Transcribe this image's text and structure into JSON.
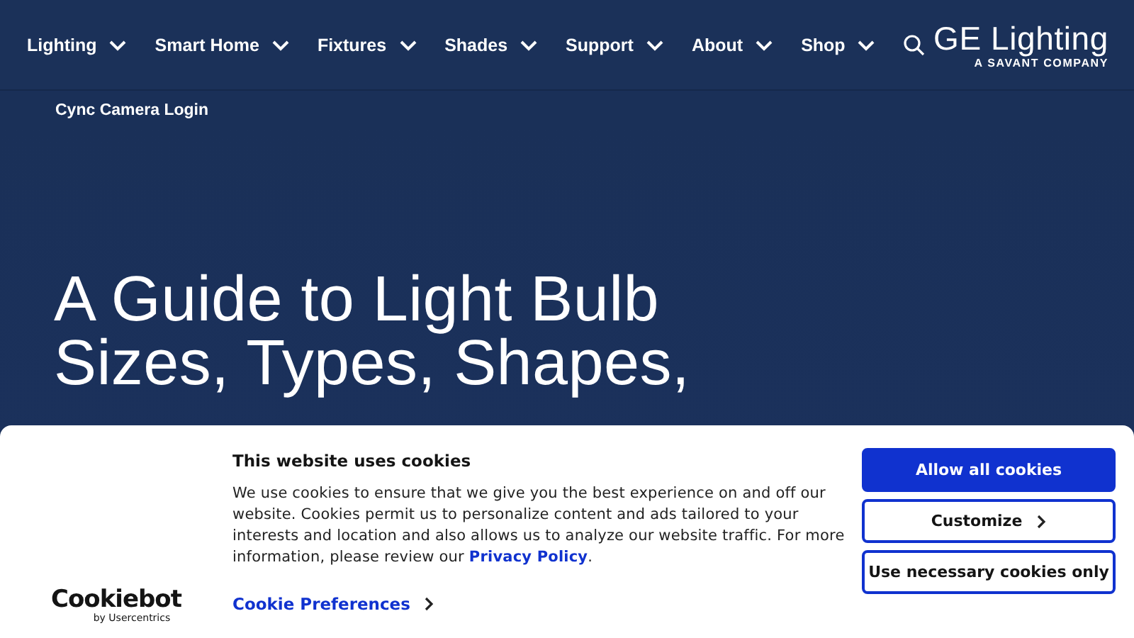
{
  "nav": {
    "items": [
      {
        "label": "Lighting"
      },
      {
        "label": "Smart Home"
      },
      {
        "label": "Fixtures"
      },
      {
        "label": "Shades"
      },
      {
        "label": "Support"
      },
      {
        "label": "About"
      },
      {
        "label": "Shop"
      }
    ],
    "logo": {
      "name": "GE Lighting",
      "tagline": "A SAVANT COMPANY"
    }
  },
  "subnav": {
    "link": "Cync Camera Login"
  },
  "hero": {
    "title_lines": [
      "A Guide to Light Bulb",
      "Sizes, Types, Shapes,"
    ]
  },
  "cookie_banner": {
    "brand": "Cookiebot",
    "brand_sub": "by Usercentrics",
    "title": "This website uses cookies",
    "body": "We use cookies to ensure that we give you the best experience on and off our website. Cookies permit us to personalize content and ads tailored to your interests and location and also allows us to analyze our website traffic.  For more information, please review our ",
    "link": "Privacy Policy",
    "body_end": ".",
    "preferences": "Cookie Preferences",
    "buttons": [
      {
        "label": "Allow all cookies",
        "kind": "primary"
      },
      {
        "label": "Customize",
        "kind": "chevron"
      },
      {
        "label": "Use necessary cookies only",
        "kind": "plain"
      }
    ]
  }
}
